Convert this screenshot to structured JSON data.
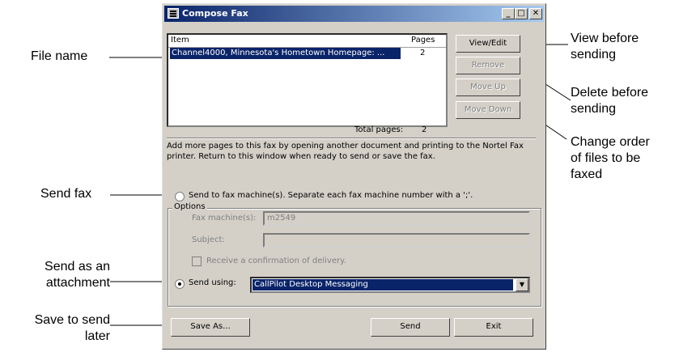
{
  "window": {
    "title": "Compose Fax"
  },
  "list": {
    "col_item": "Item",
    "col_pages": "Pages",
    "rows": [
      {
        "item": "Channel4000, Minnesota's Hometown Homepage: ...",
        "pages": "2"
      }
    ]
  },
  "buttons": {
    "view_edit": "View/Edit",
    "remove": "Remove",
    "move_up": "Move Up",
    "move_down": "Move Down",
    "save_as": "Save As...",
    "send": "Send",
    "exit": "Exit"
  },
  "total_pages_label": "Total pages:",
  "total_pages_value": "2",
  "info_line1": "Add more pages to this fax by opening another document and printing to the Nortel Fax",
  "info_line2": "printer.  Return to this window when ready to send or save the fax.",
  "options": {
    "group_label": "Options",
    "send_fax_label": "Send to fax machine(s). Separate each fax machine number with a ';'.",
    "fax_machines_label": "Fax machine(s):",
    "fax_machines_value": "m2549",
    "subject_label": "Subject:",
    "subject_value": "",
    "receive_confirmation_label": "Receive a confirmation of delivery.",
    "send_using_label": "Send using:",
    "send_using_value": "CallPilot Desktop Messaging"
  },
  "callouts": {
    "file_name": "File name",
    "send_fax": "Send fax",
    "send_attachment_1": "Send as an",
    "send_attachment_2": "attachment",
    "save_later_1": "Save to send",
    "save_later_2": "later",
    "view_before_1": "View before",
    "view_before_2": "sending",
    "delete_before_1": "Delete before",
    "delete_before_2": "sending",
    "change_order_1": "Change order",
    "change_order_2": "of files to be",
    "change_order_3": "faxed"
  },
  "icons": {
    "title_icon": "fax-icon",
    "minimize": "minimize-icon",
    "maximize": "maximize-icon",
    "close": "close-icon"
  },
  "colors": {
    "titlebar": "#0a246a",
    "selection": "#0a246a",
    "dialog": "#d4d0c8"
  }
}
